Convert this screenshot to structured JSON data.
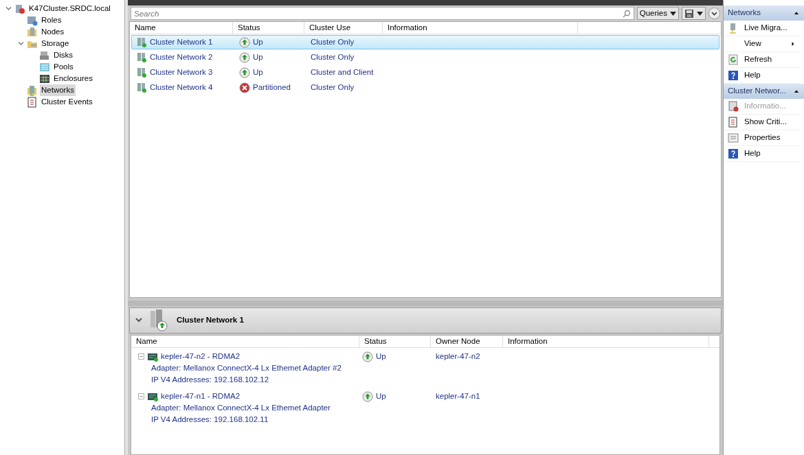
{
  "tree": [
    {
      "label": "K47Cluster.SRDC.local",
      "expanded": true,
      "selected": false,
      "children": [
        {
          "label": "Roles",
          "selected": false
        },
        {
          "label": "Nodes",
          "selected": false
        },
        {
          "label": "Storage",
          "expanded": true,
          "selected": false,
          "children": [
            {
              "label": "Disks",
              "selected": false
            },
            {
              "label": "Pools",
              "selected": false
            },
            {
              "label": "Enclosures",
              "selected": false
            }
          ]
        },
        {
          "label": "Networks",
          "selected": true
        },
        {
          "label": "Cluster Events",
          "selected": false
        }
      ]
    }
  ],
  "search": {
    "placeholder": "Search"
  },
  "toolbar": {
    "queries": "Queries"
  },
  "networks": {
    "columns": [
      "Name",
      "Status",
      "Cluster Use",
      "Information"
    ],
    "rows": [
      {
        "name": "Cluster Network 1",
        "status": "Up",
        "kind": "up",
        "use": "Cluster Only",
        "selected": true
      },
      {
        "name": "Cluster Network 2",
        "status": "Up",
        "kind": "up",
        "use": "Cluster Only",
        "selected": false
      },
      {
        "name": "Cluster Network 3",
        "status": "Up",
        "kind": "up",
        "use": "Cluster and Client",
        "selected": false
      },
      {
        "name": "Cluster Network 4",
        "status": "Partitioned",
        "kind": "partitioned",
        "use": "Cluster Only",
        "selected": false
      }
    ]
  },
  "detail": {
    "title": "Cluster Network 1",
    "columns": [
      "Name",
      "Status",
      "Owner Node",
      "Information"
    ],
    "rows": [
      {
        "name": "kepler-47-n2 - RDMA2",
        "adapter": "Adapter: Mellanox ConnectX-4 Lx Ethemet Adapter #2",
        "ip": "IP V4 Addresses: 192.168.102.12",
        "status": "Up",
        "kind": "up",
        "owner": "kepler-47-n2"
      },
      {
        "name": "kepler-47-n1 - RDMA2",
        "adapter": "Adapter: Mellanox ConnectX-4 Lx Ethemet Adapter",
        "ip": "IP V4 Addresses: 192.168.102.11",
        "status": "Up",
        "kind": "up",
        "owner": "kepler-47-n1"
      }
    ]
  },
  "actions": [
    {
      "title": "Networks",
      "items": [
        {
          "label": "Live Migra...",
          "disabled": false
        },
        {
          "label": "View",
          "submenu": true,
          "disabled": false
        },
        {
          "label": "Refresh",
          "disabled": false
        },
        {
          "label": "Help",
          "disabled": false
        }
      ]
    },
    {
      "title": "Cluster Networ...",
      "items": [
        {
          "label": "Informatio...",
          "disabled": true
        },
        {
          "label": "Show Criti...",
          "disabled": false
        },
        {
          "label": "Properties",
          "disabled": false
        },
        {
          "label": "Help",
          "disabled": false
        }
      ]
    }
  ]
}
